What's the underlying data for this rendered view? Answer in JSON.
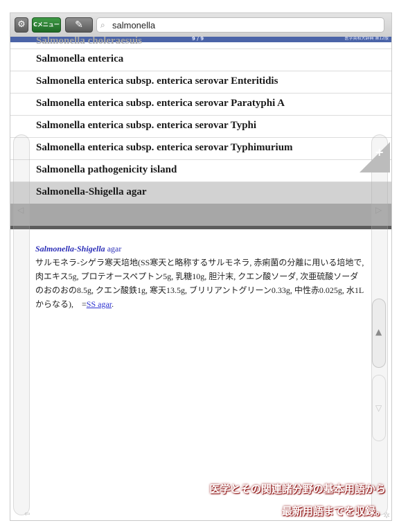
{
  "toolbar": {
    "menu_label": "Cメニュー",
    "search_value": "salmonella"
  },
  "status": {
    "count": "9 / 9",
    "dictionary": "医学英和大辞典 第12版"
  },
  "results": {
    "partial_item": "Salmonella choleraesuis",
    "items": [
      {
        "label": "Salmonella enterica"
      },
      {
        "label": "Salmonella enterica subsp. enterica serovar Enteritidis"
      },
      {
        "label": "Salmonella enterica subsp. enterica serovar Paratyphi A"
      },
      {
        "label": "Salmonella enterica subsp. enterica serovar Typhi"
      },
      {
        "label": "Salmonella enterica subsp. enterica serovar Typhimurium"
      },
      {
        "label": "Salmonella pathogenicity island"
      },
      {
        "label": "Salmonella-Shigella agar",
        "selected": true
      }
    ]
  },
  "entry": {
    "headword": "Salmonella-Shigella",
    "headword_rest": " agar",
    "body": "サルモネラ-シゲラ寒天培地(SS寒天と略称するサルモネラ, 赤痢菌の分離に用いる培地で, 肉エキス5g, プロテオースペプトン5g, 乳糖10g, 胆汁末, クエン酸ソーダ, 次亜硫酸ソーダのおのおの8.5g, クエン酸鉄1g, 寒天13.5g, ブリリアントグリーン0.33g, 中性赤0.025g, 水1Lからなる),　=",
    "link": "SS agar",
    "trailing": "."
  },
  "promo": {
    "line1": "医学とその関連諸分野の基本用語から",
    "line2": "最新用語までを収録。"
  },
  "icons": {
    "settings": "gear-icon",
    "menu": "menu-button",
    "pen": "pen-icon",
    "search": "search-icon",
    "prev": "chevron-left-icon",
    "next": "chevron-right-icon",
    "add": "plus-icon",
    "scroll_up": "triangle-up-icon",
    "scroll_down": "triangle-down-icon"
  }
}
